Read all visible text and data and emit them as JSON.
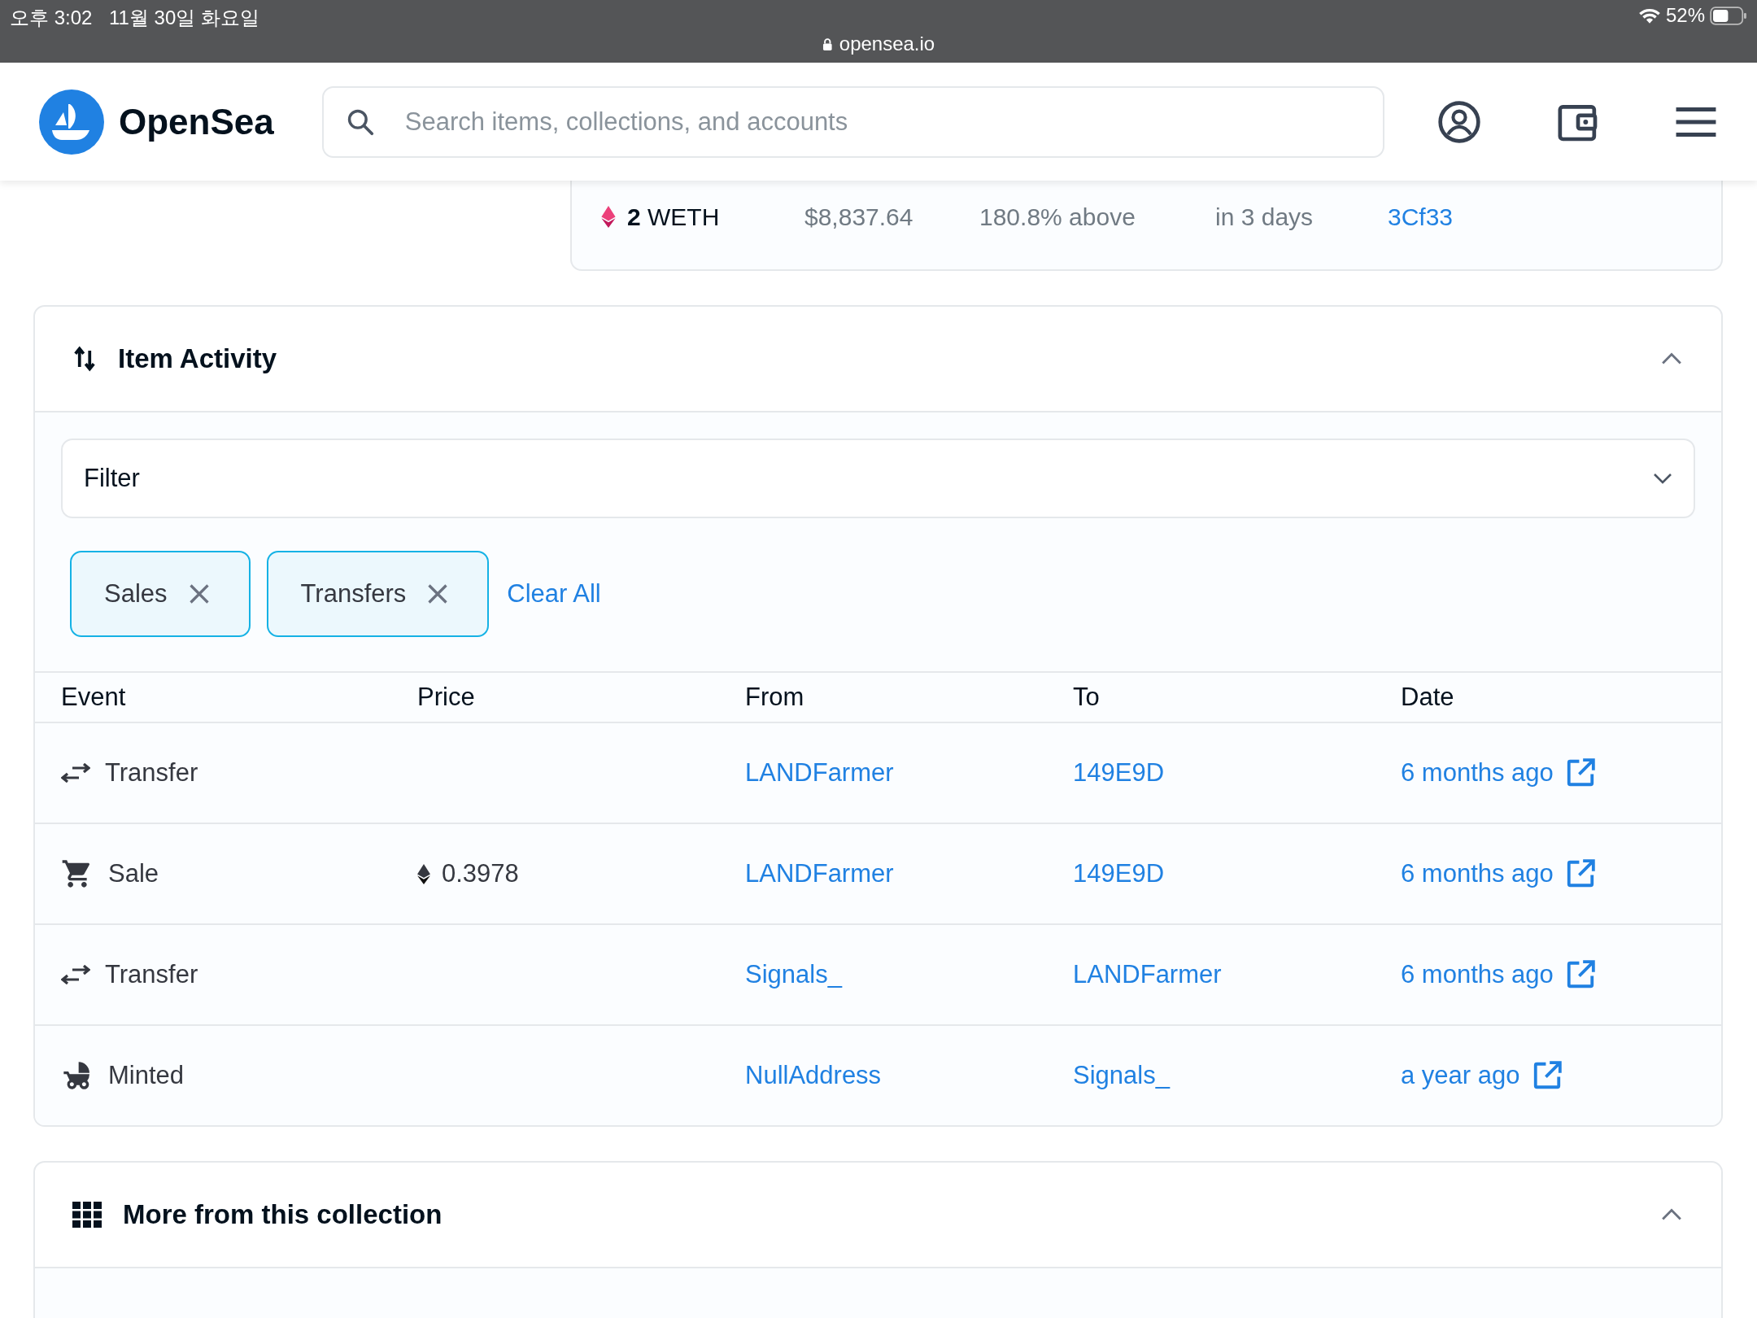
{
  "status_bar": {
    "time": "오후 3:02",
    "date": "11월 30일 화요일",
    "url": "opensea.io",
    "battery": "52%"
  },
  "header": {
    "logo_text": "OpenSea",
    "search_placeholder": "Search items, collections, and accounts"
  },
  "offer": {
    "amount": "2",
    "currency": "WETH",
    "usd_price": "$8,837.64",
    "difference": "180.8% above",
    "expiration": "in 3 days",
    "from": "3Cf33"
  },
  "activity": {
    "title": "Item Activity",
    "expanded": true,
    "filter": {
      "label": "Filter"
    },
    "chips": [
      {
        "label": "Sales"
      },
      {
        "label": "Transfers"
      }
    ],
    "clear_label": "Clear All",
    "columns": [
      "Event",
      "Price",
      "From",
      "To",
      "Date"
    ],
    "rows": [
      {
        "kind": "transfer",
        "event": "Transfer",
        "price": "",
        "from": "LANDFarmer",
        "to": "149E9D",
        "date": "6 months ago"
      },
      {
        "kind": "sale",
        "event": "Sale",
        "price": "0.3978",
        "from": "LANDFarmer",
        "to": "149E9D",
        "date": "6 months ago"
      },
      {
        "kind": "transfer",
        "event": "Transfer",
        "price": "",
        "from": "Signals_",
        "to": "LANDFarmer",
        "date": "6 months ago"
      },
      {
        "kind": "minted",
        "event": "Minted",
        "price": "",
        "from": "NullAddress",
        "to": "Signals_",
        "date": "a year ago"
      }
    ]
  },
  "more": {
    "title": "More from this collection",
    "expanded": true
  }
}
